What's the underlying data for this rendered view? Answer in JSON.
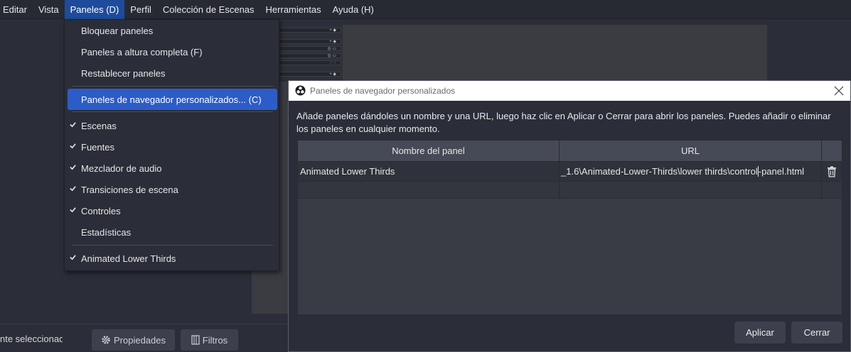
{
  "menubar": {
    "items": [
      "Editar",
      "Vista",
      "Paneles (D)",
      "Perfil",
      "Colección de Escenas",
      "Herramientas",
      "Ayuda (H)"
    ],
    "active_index": 2
  },
  "panels_menu": {
    "items": [
      {
        "label": "Bloquear paneles",
        "checked": false
      },
      {
        "label": "Paneles a altura completa (F)",
        "checked": false
      },
      {
        "label": "Restablecer paneles",
        "checked": false
      },
      {
        "label": "Paneles de navegador personalizados... (C)",
        "checked": false,
        "highlighted": true
      },
      {
        "label": "Escenas",
        "checked": true
      },
      {
        "label": "Fuentes",
        "checked": true
      },
      {
        "label": "Mezclador de audio",
        "checked": true
      },
      {
        "label": "Transiciones de escena",
        "checked": true
      },
      {
        "label": "Controles",
        "checked": true
      },
      {
        "label": "Estadísticas",
        "checked": false
      },
      {
        "label": "Animated Lower Thirds",
        "checked": true
      }
    ]
  },
  "dialog": {
    "title": "Paneles de navegador personalizados",
    "description": "Añade paneles dándoles un nombre y una URL, luego haz clic en Aplicar o Cerrar para abrir los paneles. Puedes añadir o eliminar los paneles en cualquier momento.",
    "columns": {
      "name": "Nombre del panel",
      "url": "URL"
    },
    "rows": [
      {
        "name": "Animated Lower Thirds",
        "url_before_caret": "_1.6\\Animated-Lower-Thirds\\lower thirds\\control",
        "url_after_caret": "-panel.html"
      }
    ],
    "apply_label": "Aplicar",
    "close_label": "Cerrar"
  },
  "background": {
    "status_text": "nte seleccionad",
    "properties_label": "Propiedades",
    "filters_label": "Filtros"
  },
  "colors": {
    "menu_highlight": "#2c5cc8",
    "active_menubar": "#1e4c9a",
    "background": "#2b2e38"
  }
}
